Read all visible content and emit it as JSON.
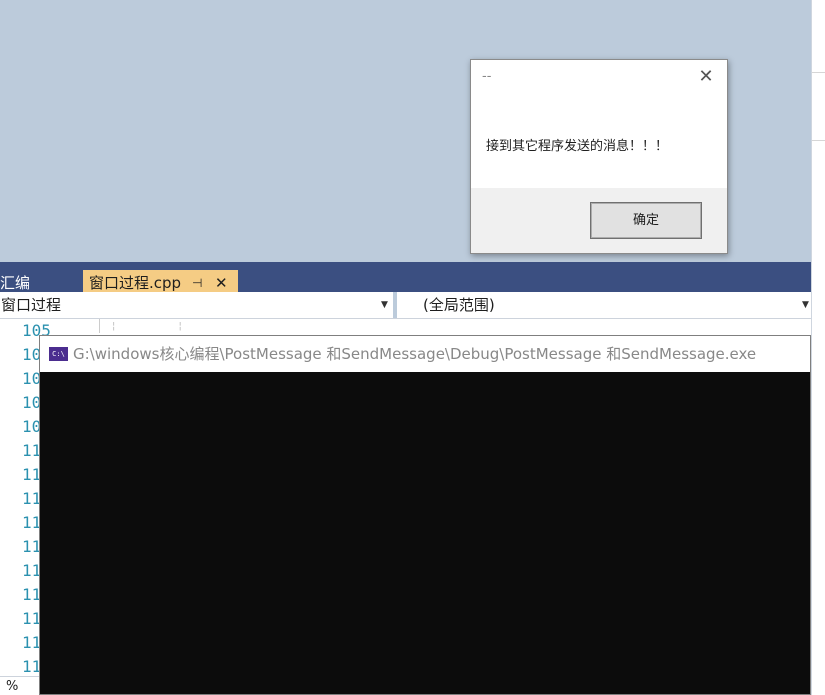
{
  "dialog": {
    "title": "--",
    "message": "接到其它程序发送的消息！！！",
    "ok_label": "确定",
    "close_glyph": "✕"
  },
  "tabs": {
    "inactive_label": "汇编",
    "active_label": "窗口过程.cpp",
    "pin_glyph": "⊣",
    "close_glyph": "✕"
  },
  "navbar": {
    "left_value": "窗口过程",
    "right_value": "(全局范围)",
    "dropdown_glyph": "▼"
  },
  "editor": {
    "line_numbers": [
      "105",
      "10",
      "10",
      "10",
      "10",
      "11",
      "11",
      "11",
      "11",
      "11",
      "11",
      "11",
      "11",
      "11",
      "11"
    ],
    "zoom_label": "%"
  },
  "console": {
    "icon_label": "C:\\",
    "title": "G:\\windows核心编程\\PostMessage 和SendMessage\\Debug\\PostMessage 和SendMessage.exe"
  }
}
